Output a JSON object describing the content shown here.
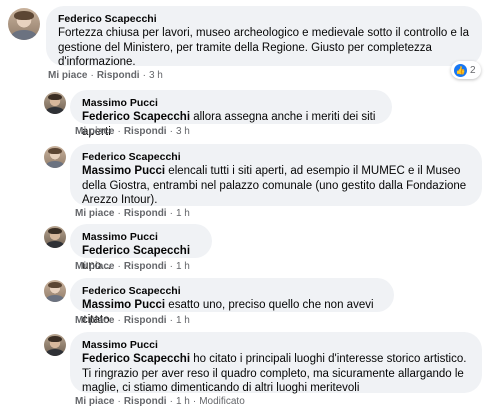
{
  "comments": [
    {
      "author": "Federico Scapecchi",
      "mention": "",
      "text": "Fortezza chiusa per lavori, museo archeologico e medievale sotto il controllo e la gestione del Ministero, per tramite della Regione. Giusto per completezza d'informazione.",
      "like": "Mi piace",
      "reply": "Rispondi",
      "time": "3 h",
      "reactions": "2",
      "edited": ""
    },
    {
      "author": "Massimo Pucci",
      "mention": "Federico Scapecchi",
      "text": "allora assegna anche i meriti dei siti aperti",
      "like": "Mi piace",
      "reply": "Rispondi",
      "time": "3 h",
      "edited": ""
    },
    {
      "author": "Federico Scapecchi",
      "mention": "Massimo Pucci",
      "text": "elencali tutti i siti aperti, ad esempio il MUMEC e il Museo della Giostra, entrambi nel palazzo comunale (uno gestito dalla Fondazione Arezzo Intour).",
      "like": "Mi piace",
      "reply": "Rispondi",
      "time": "1 h",
      "edited": ""
    },
    {
      "author": "Massimo Pucci",
      "mention": "Federico Scapecchi",
      "text": "uno...",
      "like": "Mi piace",
      "reply": "Rispondi",
      "time": "1 h",
      "edited": ""
    },
    {
      "author": "Federico Scapecchi",
      "mention": "Massimo Pucci",
      "text": "esatto uno, preciso quello che non avevi citato",
      "like": "Mi piace",
      "reply": "Rispondi",
      "time": "1 h",
      "edited": ""
    },
    {
      "author": "Massimo Pucci",
      "mention": "Federico Scapecchi",
      "text": "ho citato i principali luoghi d'interesse storico artistico. Ti ringrazio per aver reso il quadro completo, ma sicuramente allargando le maglie, ci stiamo dimenticando di altri luoghi meritevoli",
      "like": "Mi piace",
      "reply": "Rispondi",
      "time": "1 h",
      "edited": "Modificato"
    }
  ],
  "icons": {
    "like": "thumbs-up-icon"
  },
  "colors": {
    "bubble": "#f0f2f5",
    "meta": "#65676b",
    "like_badge": "#1877f2"
  }
}
